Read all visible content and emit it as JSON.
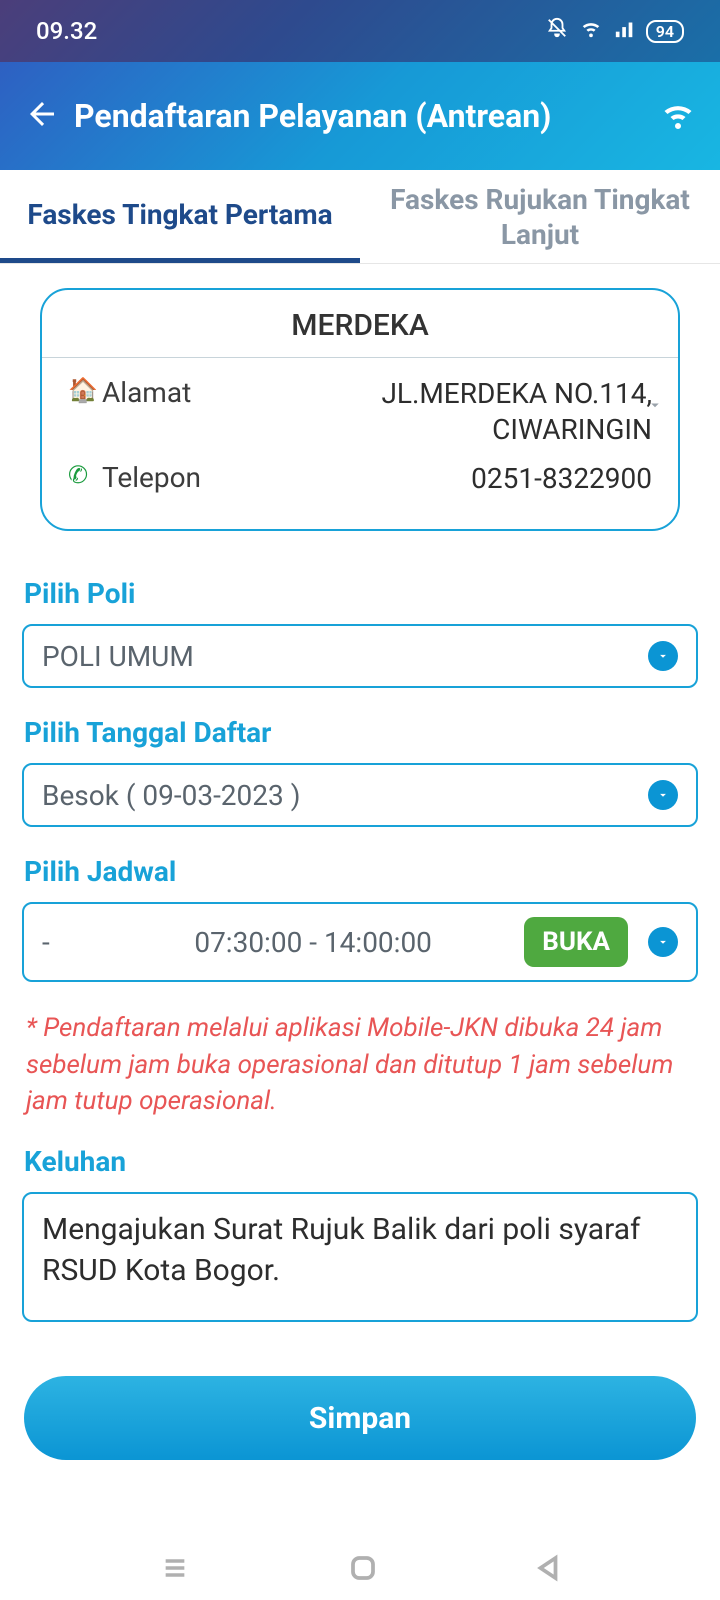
{
  "status": {
    "time": "09.32",
    "battery": "94"
  },
  "header": {
    "title": "Pendaftaran Pelayanan (Antrean)"
  },
  "tabs": {
    "primary": "Faskes Tingkat Pertama",
    "secondary": "Faskes Rujukan Tingkat Lanjut"
  },
  "faskes": {
    "name": "MERDEKA",
    "address_label": "Alamat",
    "address": "JL.MERDEKA NO.114, CIWARINGIN",
    "phone_label": "Telepon",
    "phone": "0251-8322900"
  },
  "form": {
    "poli_label": "Pilih Poli",
    "poli_value": "POLI UMUM",
    "date_label": "Pilih Tanggal Daftar",
    "date_value": "Besok ( 09-03-2023 )",
    "schedule_label": "Pilih Jadwal",
    "schedule_dash": "-",
    "schedule_time": "07:30:00 - 14:00:00",
    "schedule_status": "BUKA",
    "notice": "* Pendaftaran melalui aplikasi Mobile-JKN dibuka 24 jam sebelum jam buka operasional dan ditutup 1 jam sebelum jam tutup operasional.",
    "complaint_label": "Keluhan",
    "complaint_value": "Mengajukan Surat Rujuk Balik dari poli syaraf RSUD Kota Bogor.",
    "save_label": "Simpan"
  }
}
